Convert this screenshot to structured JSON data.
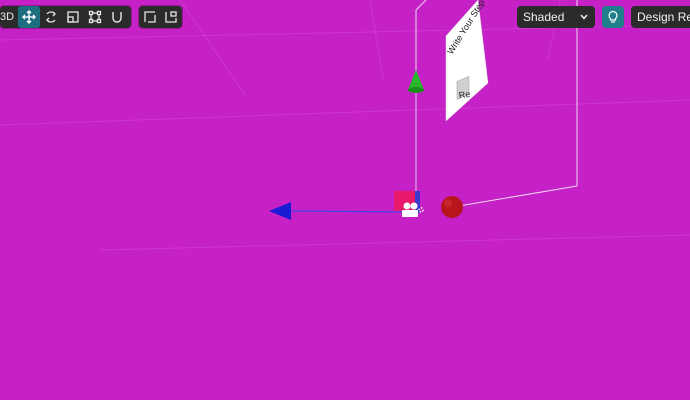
{
  "toolbar": {
    "view_mode_label": "3D",
    "tools": [
      {
        "name": "move-tool",
        "active": true
      },
      {
        "name": "rotate-tool",
        "active": false
      },
      {
        "name": "scale-tool",
        "active": false
      },
      {
        "name": "transform-tool",
        "active": false
      },
      {
        "name": "snap-tool",
        "active": false
      }
    ],
    "secondary_tools": [
      "frame-tool",
      "camera-tool"
    ]
  },
  "shading": {
    "selected": "Shaded"
  },
  "design_button_label": "Design Res",
  "scene": {
    "sign_title": "Write Your Step",
    "sign_button_label": "Re"
  },
  "colors": {
    "background": "#c621c6",
    "toolbar": "#2b2b2b",
    "accent": "#1f6e7f",
    "y_axis": "#22b323",
    "x_axis": "#1b1bd6",
    "sphere": "#b8141c"
  }
}
